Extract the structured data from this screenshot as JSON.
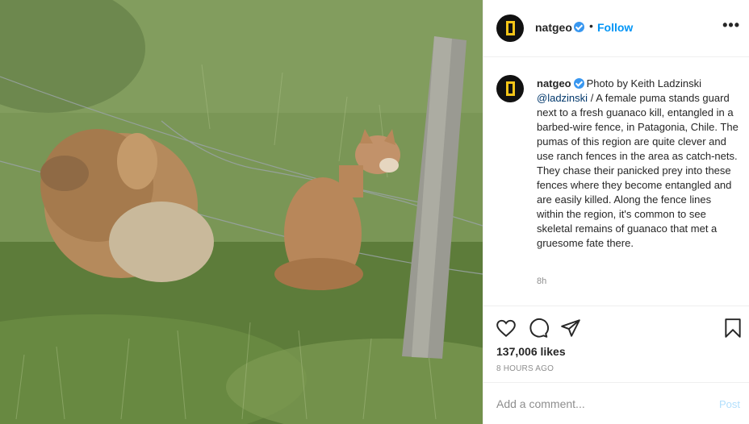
{
  "post": {
    "username": "natgeo",
    "follow_label": "Follow",
    "dot": "•",
    "more_label": "•••",
    "caption_username": "natgeo",
    "caption_credit": "Photo by Keith Ladzinski",
    "caption_mention": "@ladzinski",
    "caption_body": "/ A female puma stands guard next to a fresh guanaco kill, entangled in a barbed-wire fence, in Patagonia, Chile. The pumas of this region are quite clever and use ranch fences in the area as catch-nets. They chase their panicked prey into these fences where they become entangled and are easily killed. Along the fence lines within the region, it's common to see skeletal remains of guanaco that met a gruesome fate there.",
    "caption_time": "8h",
    "likes": "137,006 likes",
    "posted_ago": "8 HOURS AGO"
  },
  "comment": {
    "placeholder": "Add a comment...",
    "post_label": "Post"
  },
  "icons": {
    "heart": "heart-icon",
    "comment": "comment-icon",
    "share": "paper-plane-icon",
    "save": "bookmark-icon",
    "verified": "verified-badge-icon",
    "more": "more-options-icon"
  },
  "colors": {
    "link_blue": "#0095f6",
    "verified_blue": "#3897f0",
    "post_disabled": "#b2dffc",
    "logo_yellow": "#f5c518"
  }
}
